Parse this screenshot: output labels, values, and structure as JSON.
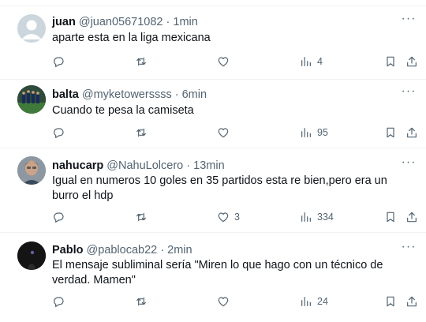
{
  "tweets": [
    {
      "name": "juan",
      "handle": "@juan05671082",
      "dot": "·",
      "time": "1min",
      "text": "aparte esta en la liga mexicana",
      "avatar": "default-avatar",
      "reply_count": "",
      "retweet_count": "",
      "like_count": "",
      "views": "4"
    },
    {
      "name": "balta",
      "handle": "@myketowerssss",
      "dot": "·",
      "time": "6min",
      "text": "Cuando te pesa la camiseta",
      "avatar": "football-team-photo",
      "reply_count": "",
      "retweet_count": "",
      "like_count": "",
      "views": "95"
    },
    {
      "name": "nahucarp",
      "handle": "@NahuLolcero",
      "dot": "·",
      "time": "13min",
      "text": "Igual en numeros 10 goles en 35 partidos esta re bien,pero era un burro el hdp",
      "avatar": "man-photo",
      "reply_count": "",
      "retweet_count": "",
      "like_count": "3",
      "views": "334"
    },
    {
      "name": "Pablo",
      "handle": "@pablocab22",
      "dot": "·",
      "time": "2min",
      "text": "El mensaje subliminal sería \"Miren lo que hago con un técnico de verdad. Mamen\"",
      "avatar": "dark-photo",
      "reply_count": "",
      "retweet_count": "",
      "like_count": "",
      "views": "24"
    }
  ],
  "more_label": "···",
  "colors": {
    "text": "#0f1419",
    "secondary": "#536471",
    "border": "#eff3f4"
  }
}
